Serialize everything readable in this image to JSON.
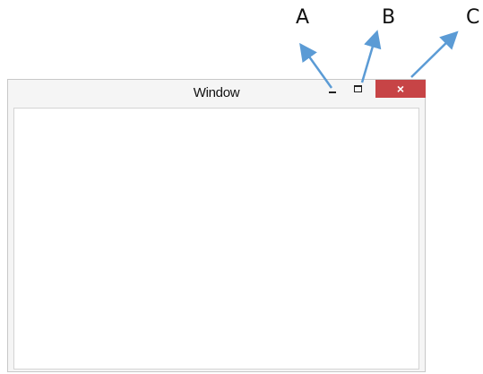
{
  "window": {
    "title": "Window",
    "close_glyph": "×",
    "minimize_icon": "minimize-icon",
    "maximize_icon": "maximize-icon",
    "close_color": "#c74446"
  },
  "annotations": {
    "label_a": "A",
    "label_b": "B",
    "label_c": "C",
    "arrow_color": "#5b9bd5"
  }
}
